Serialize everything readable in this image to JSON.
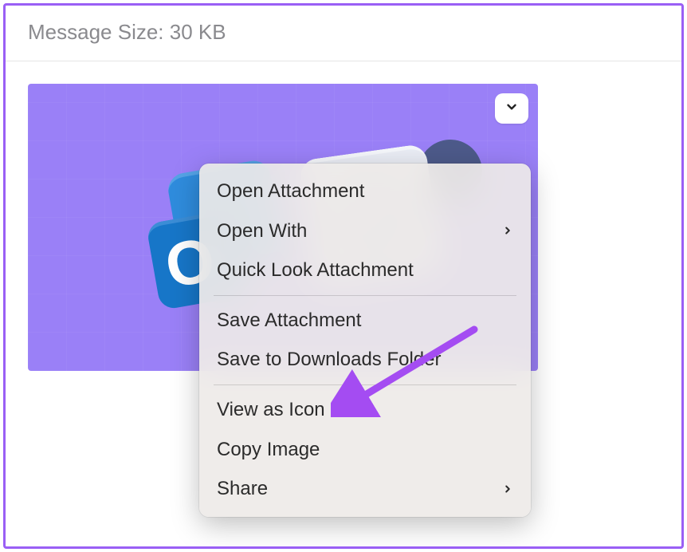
{
  "header": {
    "message_size_label": "Message Size: 30 KB"
  },
  "attachment": {
    "app_letter": "O"
  },
  "context_menu": {
    "groups": [
      {
        "items": [
          {
            "label": "Open Attachment",
            "submenu": false,
            "name": "menu-open-attachment"
          },
          {
            "label": "Open With",
            "submenu": true,
            "name": "menu-open-with"
          },
          {
            "label": "Quick Look Attachment",
            "submenu": false,
            "name": "menu-quick-look"
          }
        ]
      },
      {
        "items": [
          {
            "label": "Save Attachment",
            "submenu": false,
            "name": "menu-save-attachment"
          },
          {
            "label": "Save to Downloads Folder",
            "submenu": false,
            "name": "menu-save-downloads"
          }
        ]
      },
      {
        "items": [
          {
            "label": "View as Icon",
            "submenu": false,
            "name": "menu-view-as-icon"
          },
          {
            "label": "Copy Image",
            "submenu": false,
            "name": "menu-copy-image"
          },
          {
            "label": "Share",
            "submenu": true,
            "name": "menu-share"
          }
        ]
      }
    ]
  },
  "colors": {
    "accent": "#9a5ff5",
    "attachment_bg": "#9a80f7",
    "menu_bg": "#eeeae8"
  }
}
